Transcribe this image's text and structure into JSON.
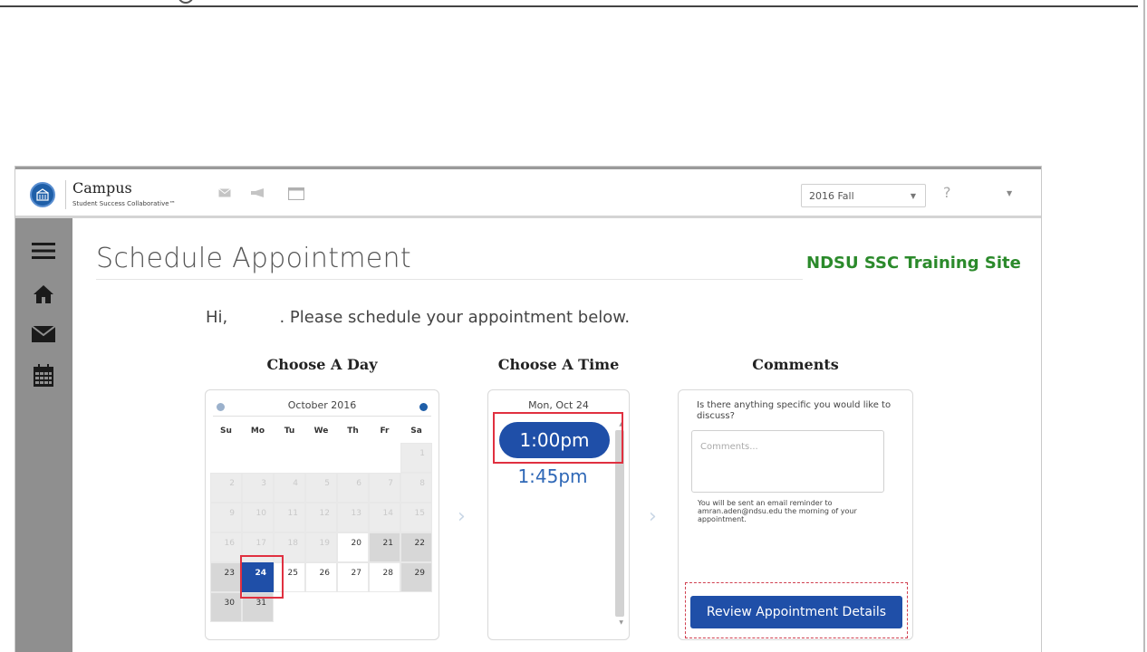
{
  "app": {
    "brand_name": "Campus",
    "brand_tagline": "Student Success Collaborative™",
    "term_selected": "2016 Fall",
    "help_label": "?"
  },
  "page": {
    "title": "Schedule Appointment",
    "site_name": "NDSU SSC Training Site",
    "greeting": "Hi,          . Please schedule your appointment below."
  },
  "columns": {
    "day_heading": "Choose A Day",
    "time_heading": "Choose A Time",
    "comments_heading": "Comments"
  },
  "calendar": {
    "month_label": "October 2016",
    "weekdays": [
      "Su",
      "Mo",
      "Tu",
      "We",
      "Th",
      "Fr",
      "Sa"
    ],
    "weeks": [
      [
        {
          "d": "",
          "s": "empty"
        },
        {
          "d": "",
          "s": "empty"
        },
        {
          "d": "",
          "s": "empty"
        },
        {
          "d": "",
          "s": "empty"
        },
        {
          "d": "",
          "s": "empty"
        },
        {
          "d": "",
          "s": "empty"
        },
        {
          "d": "1",
          "s": "past"
        }
      ],
      [
        {
          "d": "2",
          "s": "past"
        },
        {
          "d": "3",
          "s": "past"
        },
        {
          "d": "4",
          "s": "past"
        },
        {
          "d": "5",
          "s": "past"
        },
        {
          "d": "6",
          "s": "past"
        },
        {
          "d": "7",
          "s": "past"
        },
        {
          "d": "8",
          "s": "past"
        }
      ],
      [
        {
          "d": "9",
          "s": "past"
        },
        {
          "d": "10",
          "s": "past"
        },
        {
          "d": "11",
          "s": "past"
        },
        {
          "d": "12",
          "s": "past"
        },
        {
          "d": "13",
          "s": "past"
        },
        {
          "d": "14",
          "s": "past"
        },
        {
          "d": "15",
          "s": "past"
        }
      ],
      [
        {
          "d": "16",
          "s": "past"
        },
        {
          "d": "17",
          "s": "past"
        },
        {
          "d": "18",
          "s": "past"
        },
        {
          "d": "19",
          "s": "past"
        },
        {
          "d": "20",
          "s": "avail"
        },
        {
          "d": "21",
          "s": "weekend"
        },
        {
          "d": "22",
          "s": "weekend"
        }
      ],
      [
        {
          "d": "23",
          "s": "weekend"
        },
        {
          "d": "24",
          "s": "selected"
        },
        {
          "d": "25",
          "s": "avail"
        },
        {
          "d": "26",
          "s": "avail"
        },
        {
          "d": "27",
          "s": "avail"
        },
        {
          "d": "28",
          "s": "avail"
        },
        {
          "d": "29",
          "s": "weekend"
        }
      ],
      [
        {
          "d": "30",
          "s": "weekend"
        },
        {
          "d": "31",
          "s": "weekend"
        },
        {
          "d": "",
          "s": "empty"
        },
        {
          "d": "",
          "s": "empty"
        },
        {
          "d": "",
          "s": "empty"
        },
        {
          "d": "",
          "s": "empty"
        },
        {
          "d": "",
          "s": "empty"
        }
      ]
    ]
  },
  "time": {
    "date_label": "Mon, Oct 24",
    "slots": [
      "1:00pm",
      "1:45pm"
    ],
    "selected_slot": "1:00pm"
  },
  "comments": {
    "question": "Is there anything specific you would like to discuss?",
    "placeholder": "Comments...",
    "reminder": "You will be sent an email reminder to amran.aden@ndsu.edu the morning of your appointment.",
    "review_button": "Review Appointment Details"
  },
  "colors": {
    "primary": "#1f4fa8",
    "site_name_green": "#2b8a2b",
    "highlight_red": "#e03040",
    "sidebar_gray": "#8f8f8f"
  },
  "icons": {
    "logo": "university-logo-icon",
    "toolbar": [
      "envelope-icon",
      "megaphone-icon",
      "calendar-window-icon"
    ],
    "sidebar": [
      "menu-icon",
      "home-icon",
      "mail-icon",
      "calendar-icon"
    ]
  }
}
